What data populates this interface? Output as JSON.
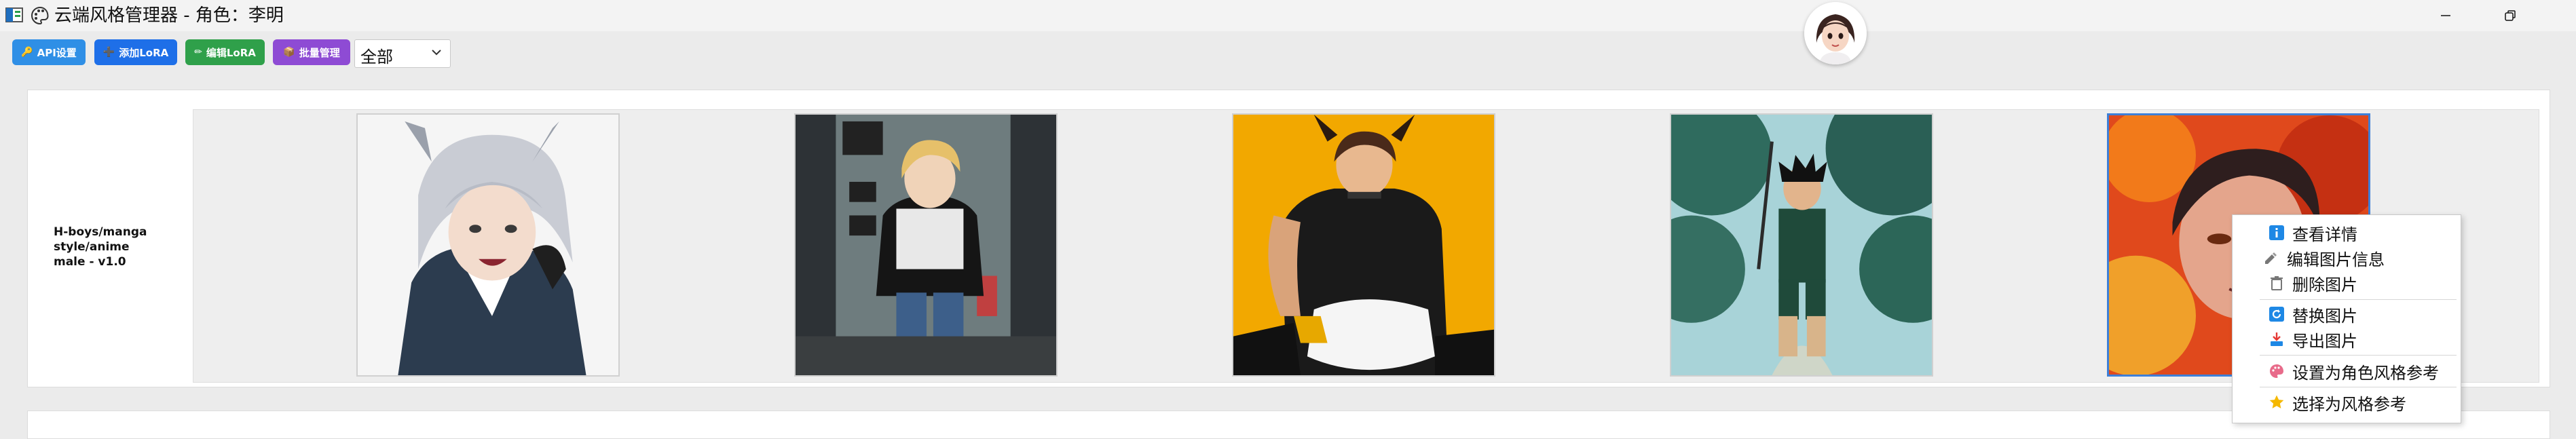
{
  "window": {
    "title": "云端风格管理器 - 角色：李明"
  },
  "toolbar": {
    "api_label": "API设置",
    "add_lora_label": "添加LoRA",
    "edit_lora_label": "编辑LoRA",
    "batch_label": "批量管理",
    "filter_value": "全部"
  },
  "lora": {
    "name": "H-boys/manga style/anime male - v1.0"
  },
  "context_menu": {
    "items": [
      {
        "label": "查看详情",
        "icon": "info-icon"
      },
      {
        "label": "编辑图片信息",
        "icon": "pencil-icon"
      },
      {
        "label": "删除图片",
        "icon": "trash-icon"
      },
      {
        "label": "替换图片",
        "icon": "refresh-icon"
      },
      {
        "label": "导出图片",
        "icon": "export-icon"
      },
      {
        "label": "设置为角色风格参考",
        "icon": "palette-icon"
      },
      {
        "label": "选择为风格参考",
        "icon": "star-icon"
      }
    ]
  },
  "colors": {
    "api_button": "#2f8fe6",
    "add_button": "#1e6fe8",
    "edit_button": "#2fa04a",
    "batch_button": "#8e4bd4",
    "selection_border": "#3d7fd8"
  }
}
